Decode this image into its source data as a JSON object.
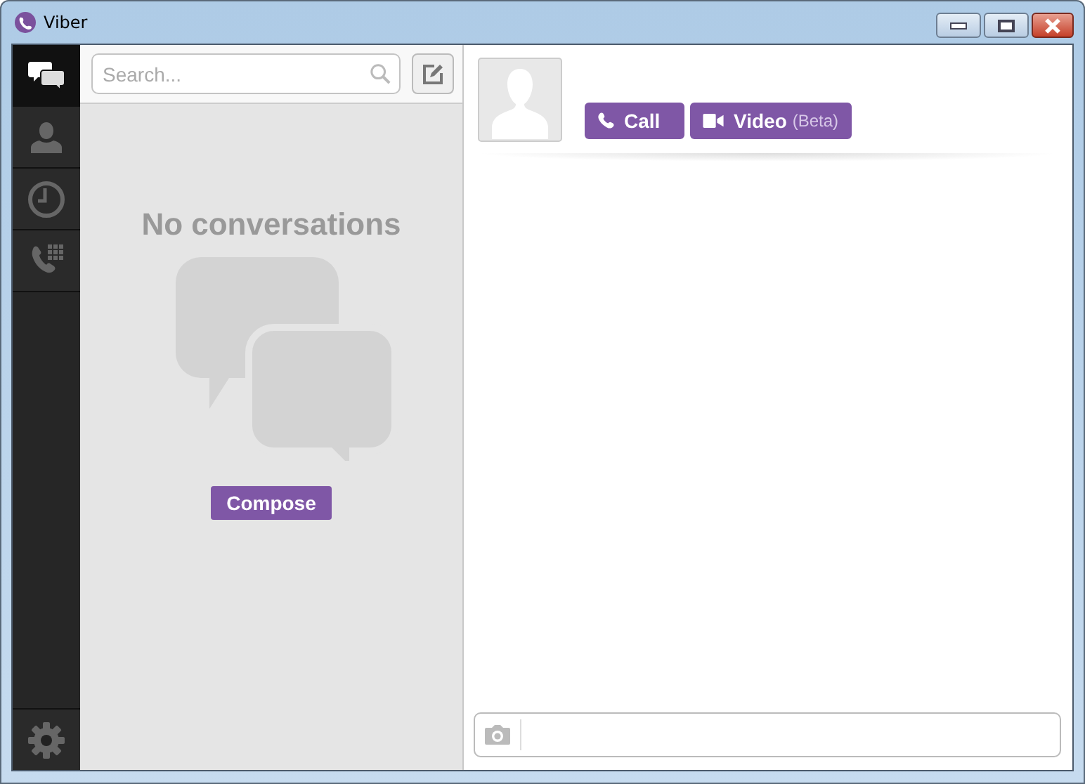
{
  "window": {
    "title": "Viber"
  },
  "sidebar": {
    "items": [
      {
        "kind": "chats",
        "selected": true
      },
      {
        "kind": "contacts",
        "selected": false
      },
      {
        "kind": "recents",
        "selected": false
      },
      {
        "kind": "dialpad",
        "selected": false
      }
    ]
  },
  "search": {
    "placeholder": "Search..."
  },
  "empty_state": {
    "title": "No conversations",
    "button": "Compose"
  },
  "contact": {
    "call_button": "Call",
    "video_button": {
      "label": "Video",
      "note": "(Beta)"
    }
  }
}
